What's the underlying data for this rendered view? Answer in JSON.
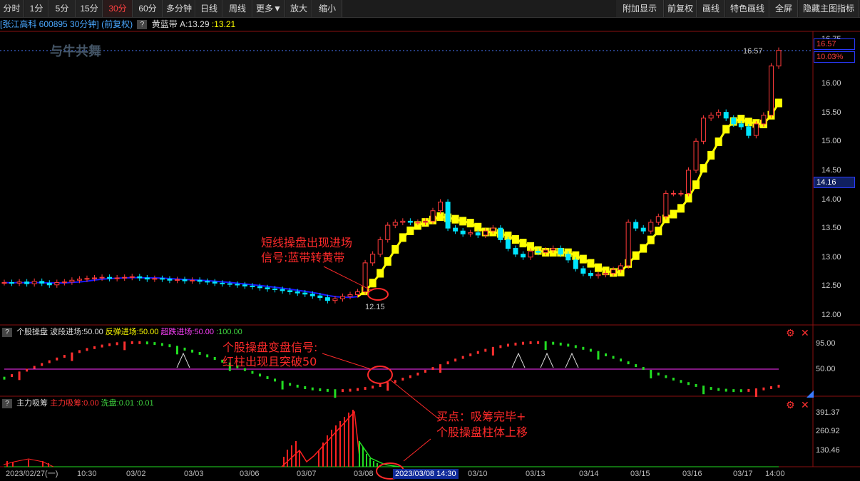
{
  "toolbar": {
    "left": [
      "分时",
      "1分",
      "5分",
      "15分",
      "30分",
      "60分",
      "多分钟",
      "日线",
      "周线",
      "更多▼",
      "放大",
      "缩小"
    ],
    "active": "30分",
    "right": [
      "附加显示",
      "前复权",
      "画线",
      "特色画线",
      "全屏",
      "隐藏主图指标"
    ]
  },
  "header": {
    "stock": "[张江高科 600895 30分钟]",
    "adj": "(前复权)",
    "indicator": "黄蓝带",
    "a_label": "A:13.29",
    "b_label": ":13.21"
  },
  "watermark": "与牛共舞",
  "price_axis": [
    "16.00",
    "15.50",
    "15.00",
    "14.50",
    "14.00",
    "13.50",
    "13.00",
    "12.50",
    "12.00"
  ],
  "price_axis_top": "16.75",
  "price_box_1": "16.57",
  "price_box_2": "10.03%",
  "price_box_3": "14.16",
  "high_label": "16.57",
  "low_label": "12.15",
  "sub1": {
    "title": "个股操盘",
    "s1": "波段进场:50.00",
    "s2": "反弹进场:50.00",
    "s3": "超跌进场:50.00",
    "s4": ":100.00",
    "axis": [
      "95.00",
      "50.00"
    ]
  },
  "sub2": {
    "title": "主力吸筹",
    "s1": "主力吸筹:0.00",
    "s2": "洗盘:0.01",
    "s3": ":0.01",
    "axis": [
      "391.37",
      "260.92",
      "130.46"
    ]
  },
  "x_axis": [
    "2023/02/27(一)",
    "10:30",
    "03/02",
    "03/03",
    "03/06",
    "03/07",
    "03/08",
    "03/10",
    "03/13",
    "03/14",
    "03/15",
    "03/16",
    "03/17",
    "14:00"
  ],
  "cursor_time": "2023/03/08 14:30",
  "annotations": {
    "a1_line1": "短线操盘出现进场",
    "a1_line2": "信号:蓝带转黄带",
    "a2_line1": "个股操盘变盘信号:",
    "a2_line2": "红柱出现且突破50",
    "a3_line1": "买点：吸筹完毕+",
    "a3_line2": "个股操盘柱体上移"
  },
  "chart_data": {
    "type": "candlestick",
    "series": [
      {
        "name": "price",
        "closes": [
          12.56,
          12.55,
          12.57,
          12.54,
          12.58,
          12.55,
          12.52,
          12.56,
          12.57,
          12.6,
          12.62,
          12.63,
          12.64,
          12.65,
          12.63,
          12.64,
          12.65,
          12.66,
          12.64,
          12.62,
          12.63,
          12.62,
          12.6,
          12.61,
          12.59,
          12.6,
          12.58,
          12.57,
          12.55,
          12.54,
          12.53,
          12.52,
          12.5,
          12.49,
          12.47,
          12.45,
          12.44,
          12.42,
          12.4,
          12.38,
          12.36,
          12.33,
          12.3,
          12.25,
          12.28,
          12.32,
          12.35,
          12.4,
          12.9,
          13.05,
          13.3,
          13.55,
          13.6,
          13.62,
          13.6,
          13.6,
          13.62,
          13.8,
          13.95,
          13.5,
          13.45,
          13.4,
          13.42,
          13.38,
          13.45,
          13.5,
          13.3,
          13.15,
          13.05,
          13.0,
          13.1,
          13.08,
          13.12,
          13.15,
          13.05,
          12.95,
          12.8,
          12.72,
          12.68,
          12.7,
          12.72,
          12.78,
          12.85,
          13.6,
          13.5,
          13.45,
          13.6,
          13.7,
          14.1,
          14.1,
          14.1,
          14.5,
          15.0,
          15.4,
          15.45,
          15.5,
          15.4,
          15.3,
          15.25,
          15.1,
          15.3,
          15.45,
          16.3,
          16.57
        ]
      }
    ],
    "yellow_band_label": "A",
    "purple_line": 50
  }
}
